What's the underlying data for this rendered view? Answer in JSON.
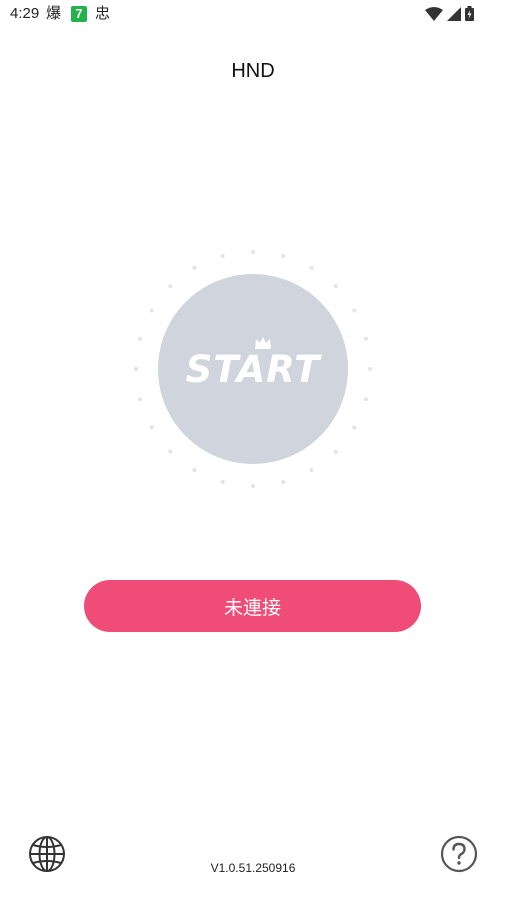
{
  "status_bar": {
    "time": "4:29",
    "app_icon_1": "爆",
    "app_icon_2": "7",
    "app_icon_3": "忠",
    "icons": [
      "wifi-icon",
      "signal-icon",
      "battery-icon"
    ]
  },
  "header": {
    "title": "HND"
  },
  "start": {
    "label": "START",
    "circle_color": "#cfd4dd"
  },
  "connect_button": {
    "label": "未連接",
    "color": "#ef4d77"
  },
  "footer": {
    "version": "V1.0.51.250916",
    "icons": [
      "globe-icon",
      "help-icon"
    ]
  }
}
